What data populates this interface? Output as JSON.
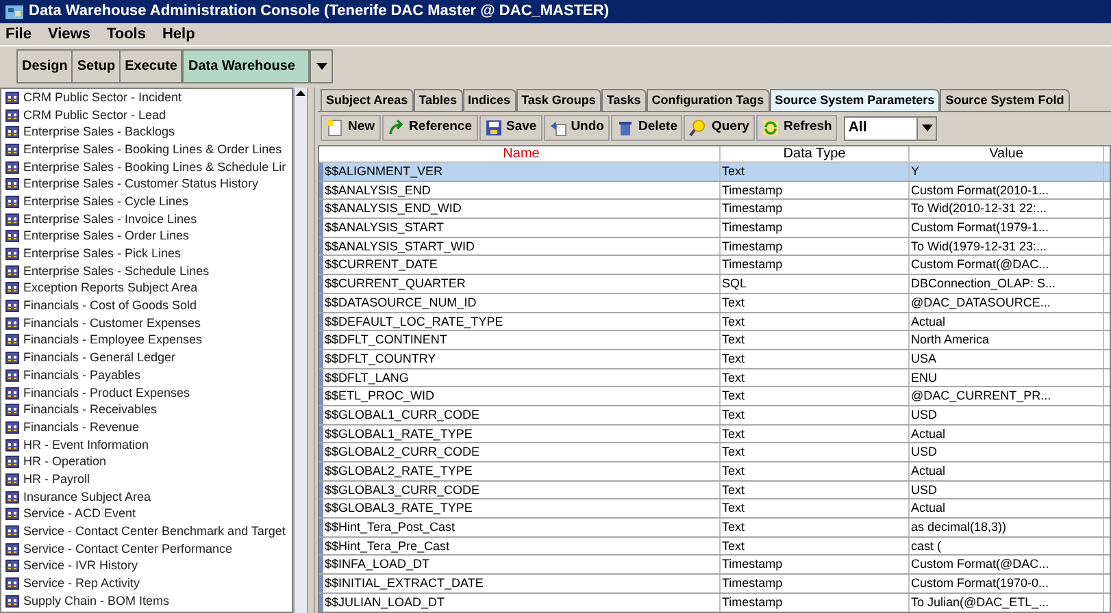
{
  "window": {
    "title": "Data Warehouse Administration Console (Tenerife DAC Master @ DAC_MASTER)"
  },
  "menu": [
    "File",
    "Views",
    "Tools",
    "Help"
  ],
  "views": [
    {
      "label": "Design",
      "selected": false
    },
    {
      "label": "Setup",
      "selected": false
    },
    {
      "label": "Execute",
      "selected": false
    },
    {
      "label": "Data Warehouse",
      "selected": true
    }
  ],
  "subject_areas": [
    "CRM Public Sector - Incident",
    "CRM Public Sector - Lead",
    "Enterprise Sales - Backlogs",
    "Enterprise Sales - Booking Lines & Order Lines",
    "Enterprise Sales - Booking Lines & Schedule Lir",
    "Enterprise Sales - Customer Status History",
    "Enterprise Sales - Cycle Lines",
    "Enterprise Sales - Invoice Lines",
    "Enterprise Sales - Order Lines",
    "Enterprise Sales - Pick Lines",
    "Enterprise Sales - Schedule Lines",
    "Exception Reports Subject Area",
    "Financials - Cost of Goods Sold",
    "Financials - Customer Expenses",
    "Financials - Employee Expenses",
    "Financials - General Ledger",
    "Financials - Payables",
    "Financials - Product Expenses",
    "Financials - Receivables",
    "Financials - Revenue",
    "HR - Event Information",
    "HR - Operation",
    "HR - Payroll",
    "Insurance Subject Area",
    "Service - ACD Event",
    "Service - Contact Center Benchmark and Target",
    "Service - Contact Center Performance",
    "Service - IVR History",
    "Service - Rep Activity",
    "Supply Chain - BOM Items"
  ],
  "tabs": [
    {
      "label": "Subject Areas",
      "selected": false
    },
    {
      "label": "Tables",
      "selected": false
    },
    {
      "label": "Indices",
      "selected": false
    },
    {
      "label": "Task Groups",
      "selected": false
    },
    {
      "label": "Tasks",
      "selected": false
    },
    {
      "label": "Configuration Tags",
      "selected": false
    },
    {
      "label": "Source System Parameters",
      "selected": true
    },
    {
      "label": "Source System Fold",
      "selected": false
    }
  ],
  "toolbar": [
    {
      "label": "New",
      "kind": "new"
    },
    {
      "label": "Reference",
      "kind": "reference"
    },
    {
      "label": "Save",
      "kind": "save"
    },
    {
      "label": "Undo",
      "kind": "undo"
    },
    {
      "label": "Delete",
      "kind": "delete"
    },
    {
      "label": "Query",
      "kind": "query"
    },
    {
      "label": "Refresh",
      "kind": "refresh"
    }
  ],
  "filter": {
    "value": "All"
  },
  "table": {
    "columns": [
      "Name",
      "Data Type",
      "Value"
    ],
    "rows": [
      {
        "cells": [
          "$$ALIGNMENT_VER",
          "Text",
          "Y"
        ],
        "selected": true
      },
      {
        "cells": [
          "$$ANALYSIS_END",
          "Timestamp",
          "Custom Format(2010-1..."
        ],
        "selected": false
      },
      {
        "cells": [
          "$$ANALYSIS_END_WID",
          "Timestamp",
          "To Wid(2010-12-31 22:..."
        ],
        "selected": false
      },
      {
        "cells": [
          "$$ANALYSIS_START",
          "Timestamp",
          "Custom Format(1979-1..."
        ],
        "selected": false
      },
      {
        "cells": [
          "$$ANALYSIS_START_WID",
          "Timestamp",
          "To Wid(1979-12-31 23:..."
        ],
        "selected": false
      },
      {
        "cells": [
          "$$CURRENT_DATE",
          "Timestamp",
          "Custom Format(@DAC..."
        ],
        "selected": false
      },
      {
        "cells": [
          "$$CURRENT_QUARTER",
          "SQL",
          "DBConnection_OLAP: S..."
        ],
        "selected": false
      },
      {
        "cells": [
          "$$DATASOURCE_NUM_ID",
          "Text",
          "@DAC_DATASOURCE..."
        ],
        "selected": false
      },
      {
        "cells": [
          "$$DEFAULT_LOC_RATE_TYPE",
          "Text",
          "Actual"
        ],
        "selected": false
      },
      {
        "cells": [
          "$$DFLT_CONTINENT",
          "Text",
          "North America"
        ],
        "selected": false
      },
      {
        "cells": [
          "$$DFLT_COUNTRY",
          "Text",
          "USA"
        ],
        "selected": false
      },
      {
        "cells": [
          "$$DFLT_LANG",
          "Text",
          "ENU"
        ],
        "selected": false
      },
      {
        "cells": [
          "$$ETL_PROC_WID",
          "Text",
          "@DAC_CURRENT_PR..."
        ],
        "selected": false
      },
      {
        "cells": [
          "$$GLOBAL1_CURR_CODE",
          "Text",
          "USD"
        ],
        "selected": false
      },
      {
        "cells": [
          "$$GLOBAL1_RATE_TYPE",
          "Text",
          "Actual"
        ],
        "selected": false
      },
      {
        "cells": [
          "$$GLOBAL2_CURR_CODE",
          "Text",
          "USD"
        ],
        "selected": false
      },
      {
        "cells": [
          "$$GLOBAL2_RATE_TYPE",
          "Text",
          "Actual"
        ],
        "selected": false
      },
      {
        "cells": [
          "$$GLOBAL3_CURR_CODE",
          "Text",
          "USD"
        ],
        "selected": false
      },
      {
        "cells": [
          "$$GLOBAL3_RATE_TYPE",
          "Text",
          "Actual"
        ],
        "selected": false
      },
      {
        "cells": [
          "$$Hint_Tera_Post_Cast",
          "Text",
          "as decimal(18,3))"
        ],
        "selected": false
      },
      {
        "cells": [
          "$$Hint_Tera_Pre_Cast",
          "Text",
          "cast ("
        ],
        "selected": false
      },
      {
        "cells": [
          "$$INFA_LOAD_DT",
          "Timestamp",
          "Custom Format(@DAC..."
        ],
        "selected": false
      },
      {
        "cells": [
          "$$INITIAL_EXTRACT_DATE",
          "Timestamp",
          "Custom Format(1970-0..."
        ],
        "selected": false
      },
      {
        "cells": [
          "$$JULIAN_LOAD_DT",
          "Timestamp",
          "To Julian(@DAC_ETL_..."
        ],
        "selected": false
      }
    ]
  }
}
